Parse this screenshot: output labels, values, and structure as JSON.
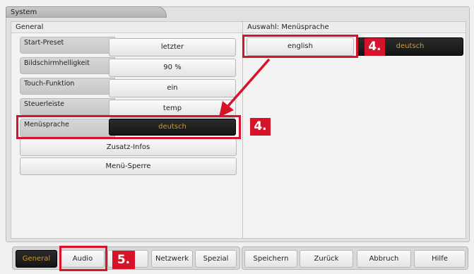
{
  "window": {
    "title": "System"
  },
  "left_panel": {
    "title": "General",
    "settings": [
      {
        "label": "Start-Preset",
        "value": "letzter"
      },
      {
        "label": "Bildschirmhelligkeit",
        "value": "90 %"
      },
      {
        "label": "Touch-Funktion",
        "value": "ein"
      },
      {
        "label": "Steuerleiste",
        "value": "temp"
      },
      {
        "label": "Menüsprache",
        "value": "deutsch"
      }
    ],
    "extra_buttons": [
      "Zusatz-Infos",
      "Menü-Sperre"
    ]
  },
  "right_panel": {
    "title": "Auswahl: Menüsprache",
    "options": [
      "english",
      "deutsch"
    ]
  },
  "annotations": {
    "step_four": "4.",
    "step_five": "5."
  },
  "bottom_bar": {
    "left_tabs": [
      "General",
      "Audio",
      "",
      "Netzwerk",
      "Spezial"
    ],
    "actions": [
      "Speichern",
      "Zurück",
      "Abbruch",
      "Hilfe"
    ]
  },
  "colors": {
    "annotation_red": "#d5142a",
    "selected_text": "#d39a28",
    "selected_bg": "#1c1c1c"
  }
}
